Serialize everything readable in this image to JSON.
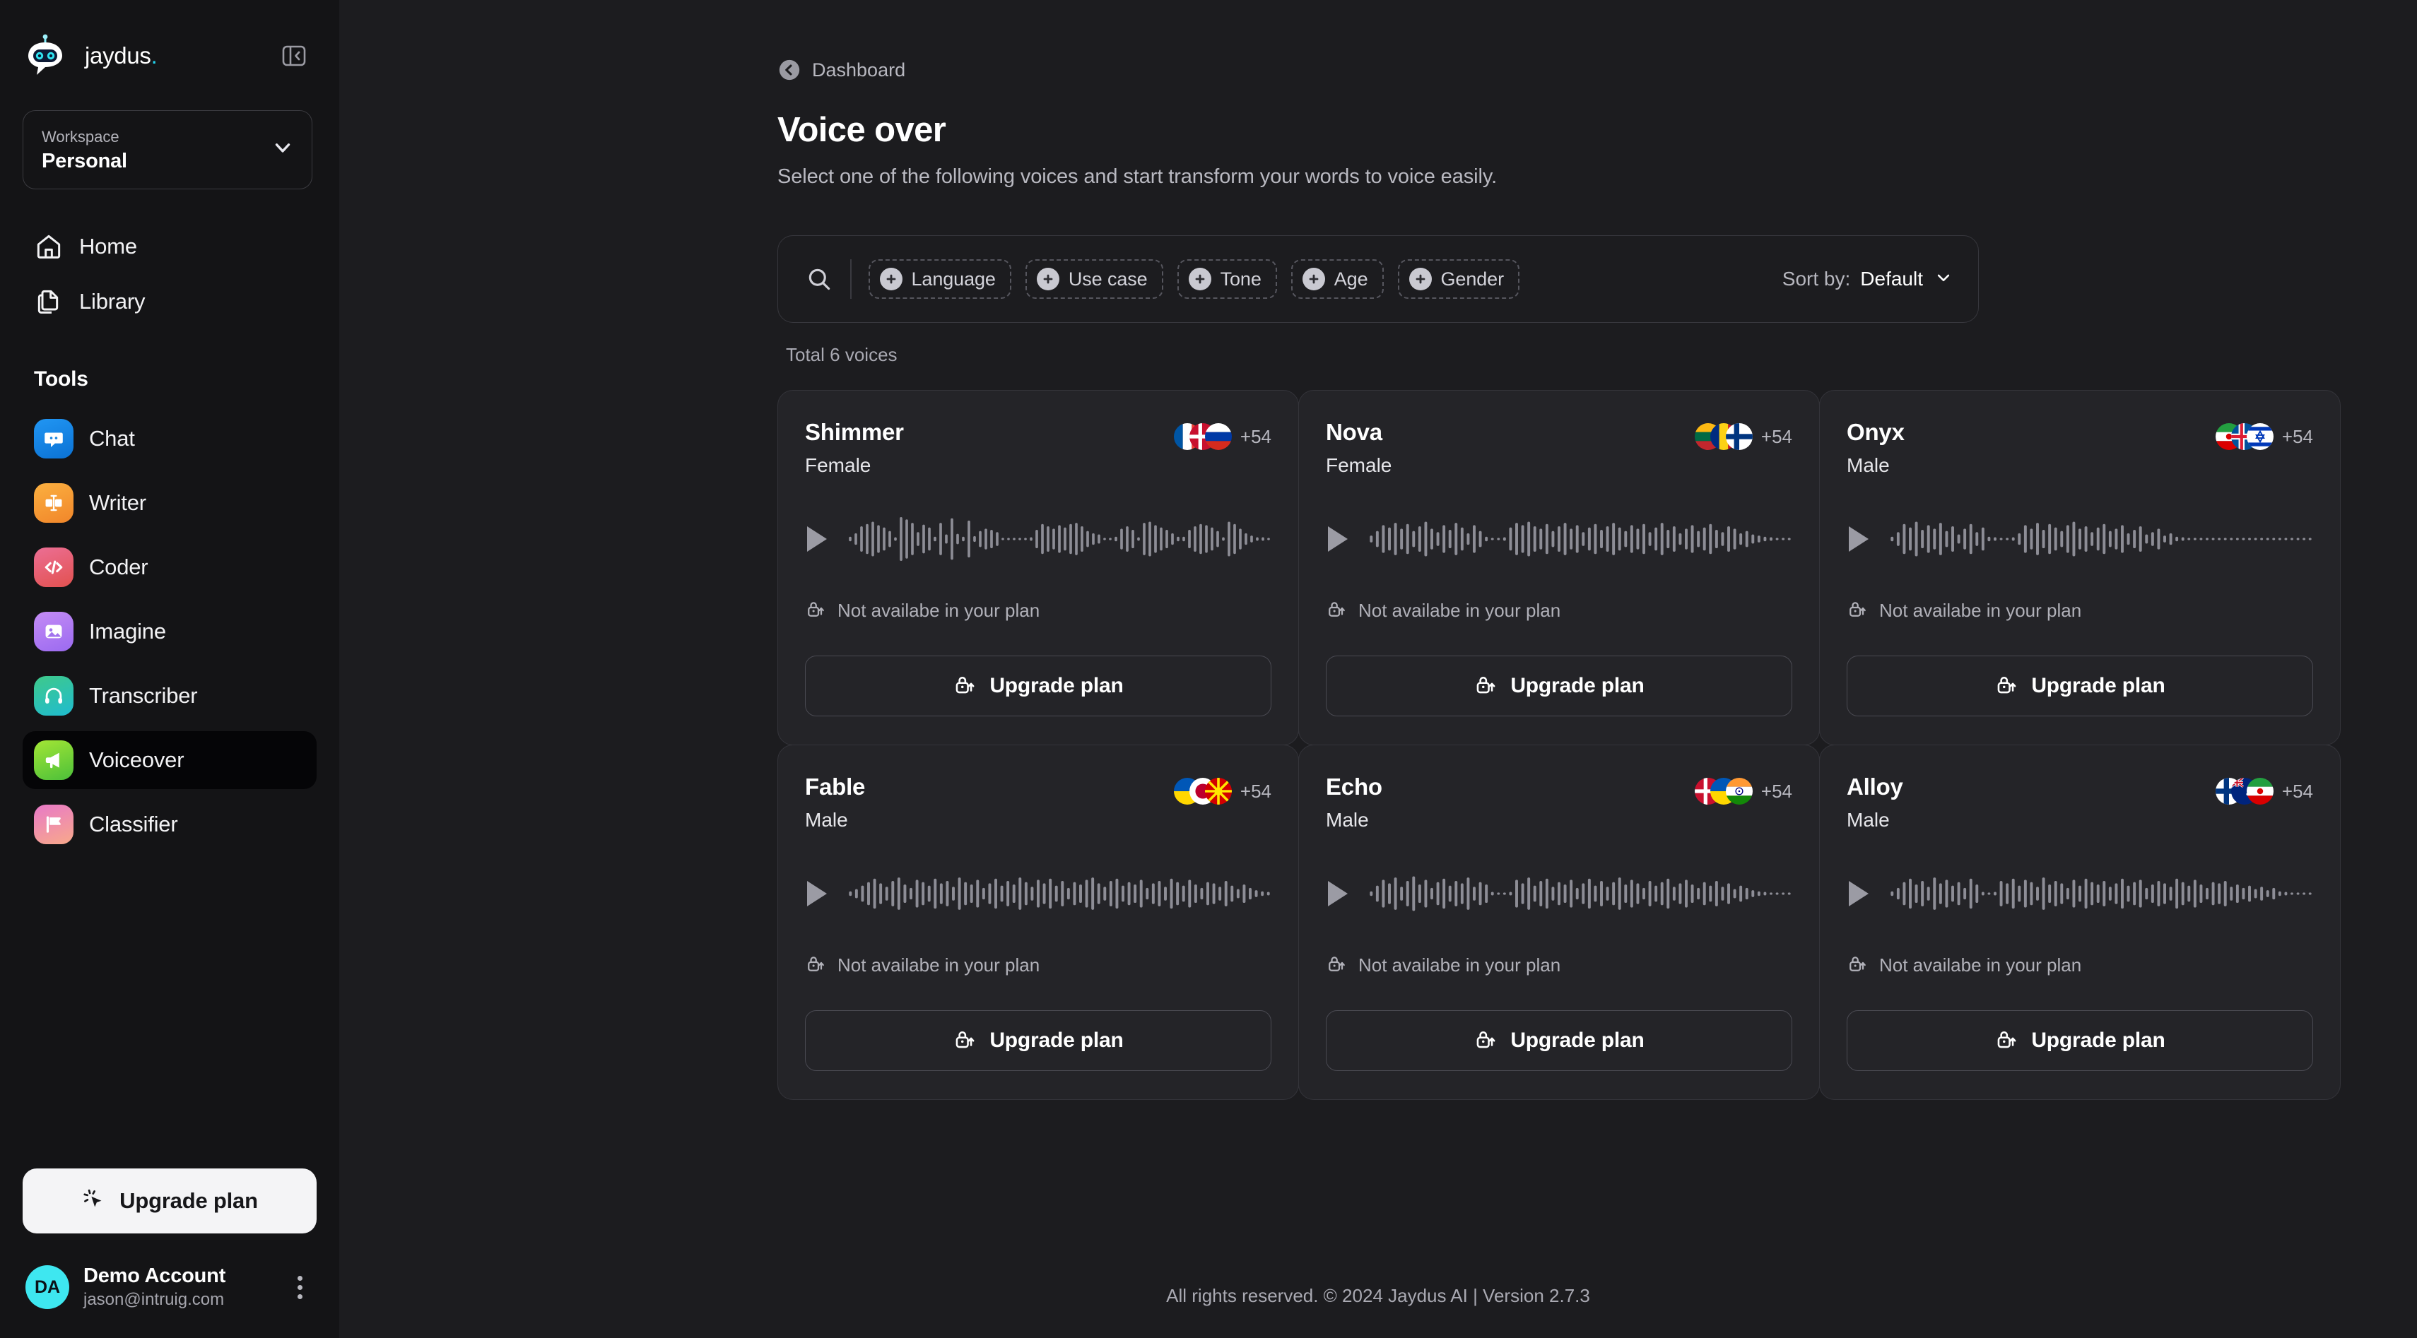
{
  "brand": {
    "name": "jaydus",
    "dot": ".",
    "logo_icon": "robot-logo-icon",
    "collapse_icon": "sidebar-collapse-icon"
  },
  "workspace": {
    "label": "Workspace",
    "value": "Personal",
    "chevron_icon": "chevron-down-icon"
  },
  "nav": [
    {
      "label": "Home",
      "icon": "home-icon"
    },
    {
      "label": "Library",
      "icon": "library-icon"
    }
  ],
  "tools_heading": "Tools",
  "tools": [
    {
      "label": "Chat",
      "icon": "chat-icon",
      "active": false,
      "color_a": "#2196f3",
      "color_b": "#0b72d4"
    },
    {
      "label": "Writer",
      "icon": "writer-icon",
      "active": false,
      "color_a": "#fbb040",
      "color_b": "#f1862a"
    },
    {
      "label": "Coder",
      "icon": "coder-icon",
      "active": false,
      "color_a": "#ec6f95",
      "color_b": "#e2514f"
    },
    {
      "label": "Imagine",
      "icon": "imagine-icon",
      "active": false,
      "color_a": "#c48cf5",
      "color_b": "#9b6af0"
    },
    {
      "label": "Transcriber",
      "icon": "transcriber-icon",
      "active": false,
      "color_a": "#3fc98a",
      "color_b": "#1fbcd0"
    },
    {
      "label": "Voiceover",
      "icon": "voiceover-icon",
      "active": true,
      "color_a": "#a3e635",
      "color_b": "#4cc03a"
    },
    {
      "label": "Classifier",
      "icon": "classifier-icon",
      "active": false,
      "color_a": "#e879c8",
      "color_b": "#f8a98a"
    }
  ],
  "sidebar_upgrade": {
    "label": "Upgrade plan",
    "icon": "cursor-sparkle-icon"
  },
  "account": {
    "initials": "DA",
    "name": "Demo Account",
    "email": "jason@intruig.com",
    "menu_icon": "kebab-menu-icon"
  },
  "breadcrumb": {
    "label": "Dashboard",
    "icon": "arrow-left-circle-icon"
  },
  "page": {
    "title": "Voice over",
    "subtitle": "Select one of the following voices and start transform your words to voice easily."
  },
  "toolbar": {
    "search_icon": "search-icon",
    "filters": [
      {
        "label": "Language",
        "icon": "plus-circle-icon"
      },
      {
        "label": "Use case",
        "icon": "plus-circle-icon"
      },
      {
        "label": "Tone",
        "icon": "plus-circle-icon"
      },
      {
        "label": "Age",
        "icon": "plus-circle-icon"
      },
      {
        "label": "Gender",
        "icon": "plus-circle-icon"
      }
    ],
    "sort_label": "Sort by:",
    "sort_value": "Default",
    "sort_icon": "chevron-down-icon"
  },
  "total_text": "Total 6 voices",
  "cards": [
    {
      "name": "Shimmer",
      "gender": "Female",
      "flag_count": "+54",
      "flags": [
        "france",
        "denmark",
        "russia"
      ],
      "notice": "Not availabe in your plan",
      "notice_icon": "lock-up-icon",
      "upgrade_label": "Upgrade plan",
      "upgrade_icon": "lock-up-icon",
      "play_icon": "play-icon",
      "wave": [
        4,
        10,
        22,
        26,
        30,
        24,
        20,
        14,
        3,
        38,
        34,
        28,
        12,
        25,
        20,
        4,
        28,
        8,
        36,
        9,
        4,
        32,
        5,
        14,
        18,
        16,
        12,
        2,
        2,
        2,
        2,
        2,
        3,
        16,
        26,
        22,
        18,
        24,
        20,
        26,
        28,
        22,
        14,
        10,
        8,
        2,
        2,
        4,
        18,
        22,
        16,
        3,
        28,
        30,
        24,
        20,
        16,
        10,
        4,
        4,
        16,
        22,
        26,
        24,
        20,
        14,
        3,
        30,
        26,
        18,
        10,
        6,
        3,
        3,
        2
      ]
    },
    {
      "name": "Nova",
      "gender": "Female",
      "flag_count": "+54",
      "flags": [
        "lithuania",
        "romania",
        "finland"
      ],
      "notice": "Not availabe in your plan",
      "notice_icon": "lock-up-icon",
      "upgrade_label": "Upgrade plan",
      "upgrade_icon": "lock-up-icon",
      "play_icon": "play-icon",
      "wave": [
        6,
        14,
        24,
        20,
        28,
        18,
        26,
        14,
        22,
        30,
        18,
        12,
        24,
        16,
        28,
        20,
        10,
        24,
        14,
        4,
        2,
        2,
        3,
        20,
        28,
        24,
        30,
        22,
        18,
        26,
        14,
        22,
        28,
        18,
        24,
        12,
        20,
        26,
        16,
        22,
        28,
        20,
        14,
        24,
        18,
        26,
        12,
        20,
        28,
        16,
        22,
        10,
        18,
        24,
        14,
        20,
        26,
        16,
        12,
        22,
        18,
        10,
        14,
        8,
        6,
        4,
        3,
        2,
        2,
        2
      ]
    },
    {
      "name": "Onyx",
      "gender": "Male",
      "flag_count": "+54",
      "flags": [
        "iran",
        "iceland",
        "israel"
      ],
      "notice": "Not availabe in your plan",
      "notice_icon": "lock-up-icon",
      "upgrade_label": "Upgrade plan",
      "upgrade_icon": "lock-up-icon",
      "play_icon": "play-icon",
      "wave": [
        4,
        12,
        26,
        20,
        30,
        16,
        24,
        18,
        28,
        14,
        22,
        8,
        18,
        26,
        12,
        20,
        4,
        3,
        2,
        2,
        3,
        10,
        24,
        18,
        28,
        16,
        26,
        20,
        14,
        24,
        30,
        18,
        22,
        12,
        20,
        26,
        14,
        18,
        24,
        10,
        16,
        22,
        8,
        12,
        18,
        6,
        10,
        4,
        3,
        2,
        2,
        2,
        2,
        2,
        2,
        2,
        2,
        2,
        2,
        2,
        2,
        2,
        2,
        2,
        2,
        2,
        2,
        2,
        2,
        2
      ]
    },
    {
      "name": "Fable",
      "gender": "Male",
      "flag_count": "+54",
      "flags": [
        "ukraine",
        "japan",
        "north-macedonia"
      ],
      "notice": "Not availabe in your plan",
      "notice_icon": "lock-up-icon",
      "upgrade_label": "Upgrade plan",
      "upgrade_icon": "lock-up-icon",
      "play_icon": "play-icon",
      "wave": [
        4,
        8,
        14,
        20,
        26,
        18,
        12,
        22,
        28,
        16,
        10,
        24,
        20,
        14,
        26,
        18,
        22,
        12,
        28,
        20,
        16,
        24,
        10,
        18,
        26,
        14,
        22,
        16,
        28,
        20,
        12,
        24,
        18,
        26,
        14,
        22,
        10,
        20,
        16,
        24,
        28,
        18,
        12,
        22,
        26,
        14,
        20,
        16,
        24,
        10,
        18,
        22,
        12,
        26,
        20,
        14,
        24,
        16,
        10,
        20,
        18,
        12,
        22,
        14,
        8,
        16,
        10,
        6,
        4,
        3
      ]
    },
    {
      "name": "Echo",
      "gender": "Male",
      "flag_count": "+54",
      "flags": [
        "denmark",
        "ukraine",
        "india"
      ],
      "notice": "Not availabe in your plan",
      "notice_icon": "lock-up-icon",
      "upgrade_label": "Upgrade plan",
      "upgrade_icon": "lock-up-icon",
      "play_icon": "play-icon",
      "wave": [
        4,
        14,
        24,
        18,
        28,
        12,
        22,
        30,
        16,
        24,
        10,
        20,
        26,
        14,
        22,
        18,
        28,
        12,
        20,
        16,
        3,
        2,
        2,
        3,
        24,
        18,
        28,
        14,
        22,
        26,
        12,
        20,
        16,
        24,
        10,
        18,
        26,
        14,
        22,
        12,
        20,
        28,
        16,
        24,
        18,
        10,
        22,
        14,
        20,
        26,
        12,
        18,
        24,
        16,
        10,
        20,
        14,
        22,
        12,
        18,
        8,
        14,
        10,
        6,
        4,
        3,
        2,
        2,
        2,
        2
      ]
    },
    {
      "name": "Alloy",
      "gender": "Male",
      "flag_count": "+54",
      "flags": [
        "finland",
        "new-zealand",
        "iran"
      ],
      "notice": "Not availabe in your plan",
      "notice_icon": "lock-up-icon",
      "upgrade_label": "Upgrade plan",
      "upgrade_icon": "lock-up-icon",
      "play_icon": "play-icon",
      "wave": [
        4,
        10,
        20,
        26,
        16,
        22,
        12,
        28,
        18,
        24,
        14,
        20,
        10,
        26,
        16,
        3,
        2,
        3,
        22,
        18,
        26,
        14,
        24,
        20,
        12,
        28,
        16,
        22,
        18,
        10,
        24,
        14,
        26,
        20,
        16,
        22,
        12,
        18,
        26,
        14,
        20,
        24,
        10,
        16,
        22,
        18,
        12,
        26,
        20,
        14,
        24,
        16,
        10,
        20,
        18,
        22,
        12,
        16,
        10,
        14,
        8,
        12,
        6,
        10,
        4,
        3,
        2,
        2,
        2,
        2
      ]
    }
  ],
  "footer": "All rights reserved. © 2024 Jaydus AI | Version 2.7.3"
}
